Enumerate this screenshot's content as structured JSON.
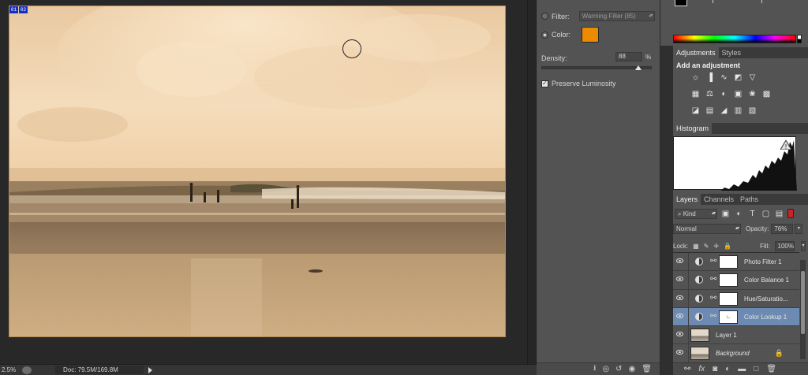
{
  "canvas": {
    "markers": [
      "01",
      "02"
    ]
  },
  "status_bar": {
    "zoom": "2.5%",
    "doc_info": "Doc: 79.5M/169.8M"
  },
  "properties": {
    "filter_label": "Filter:",
    "filter_value": "Warming Filter (85)",
    "color_label": "Color:",
    "color_value": "#ec8a00",
    "density_label": "Density:",
    "density_value": "88",
    "density_unit": "%",
    "density_fraction": 0.88,
    "preserve_label": "Preserve Luminosity",
    "footer_icons": [
      "clip-icon",
      "view-previous-icon",
      "reset-icon",
      "visibility-icon",
      "trash-icon"
    ]
  },
  "adjustments_panel": {
    "tabs": [
      "Adjustments",
      "Styles"
    ],
    "title": "Add an adjustment"
  },
  "histogram_panel": {
    "tabs": [
      "Histogram"
    ]
  },
  "layers_panel": {
    "tabs": [
      "Layers",
      "Channels",
      "Paths"
    ],
    "kind_label": "Kind",
    "blend_mode": "Normal",
    "opacity_label": "Opacity:",
    "opacity_value": "76%",
    "lock_label": "Lock:",
    "fill_label": "Fill:",
    "fill_value": "100%",
    "layers": [
      {
        "name": "Photo Filter 1",
        "type": "adjustment",
        "selected": false
      },
      {
        "name": "Color Balance 1",
        "type": "adjustment",
        "selected": false
      },
      {
        "name": "Hue/Saturatio...",
        "type": "adjustment",
        "selected": false
      },
      {
        "name": "Color Lookup 1",
        "type": "adjustment",
        "selected": true
      },
      {
        "name": "Layer 1",
        "type": "pixel",
        "selected": false
      },
      {
        "name": "Background",
        "type": "background",
        "selected": false
      }
    ],
    "footer_icons": [
      "link-icon",
      "fx-icon",
      "mask-icon",
      "adjustment-icon",
      "group-icon",
      "new-layer-icon",
      "trash-icon"
    ]
  },
  "colors": {
    "panel": "#535353",
    "selected_layer": "#6d8ab3",
    "photo_filter_color": "#ec8a00"
  }
}
